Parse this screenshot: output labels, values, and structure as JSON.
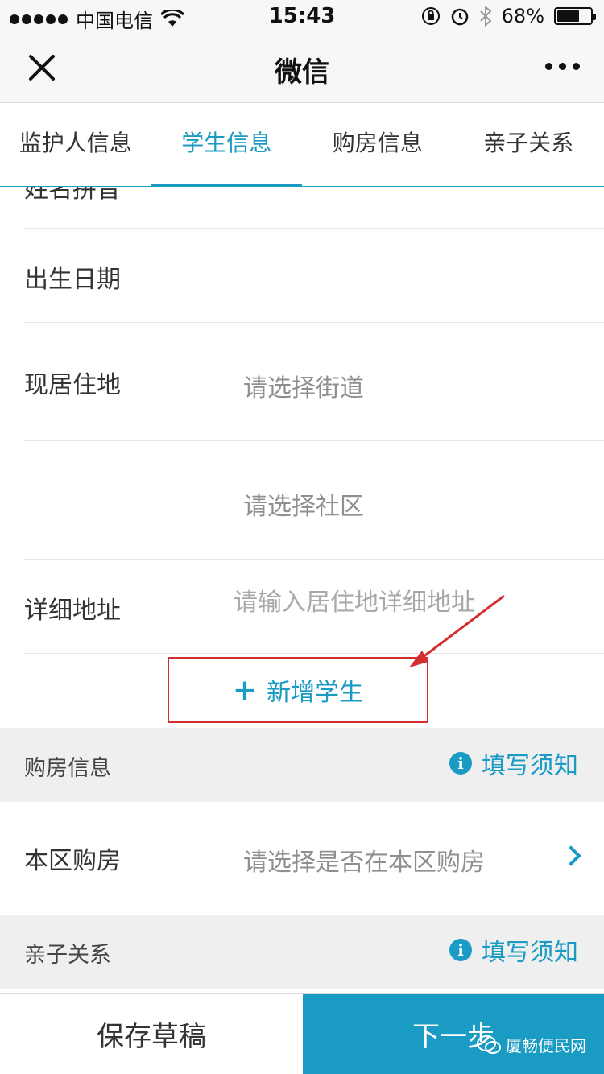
{
  "status": {
    "carrier": "中国电信",
    "time": "15:43",
    "battery_text": "68%",
    "battery_level": 0.68
  },
  "nav": {
    "title": "微信"
  },
  "tabs": [
    {
      "label": "监护人信息"
    },
    {
      "label": "学生信息"
    },
    {
      "label": "购房信息"
    },
    {
      "label": "亲子关系"
    }
  ],
  "form": {
    "cutoff_label": "姓名拼音",
    "birth_label": "出生日期",
    "residence_label": "现居住地",
    "street_placeholder": "请选择街道",
    "community_placeholder": "请选择社区",
    "address_label": "详细地址",
    "address_placeholder": "请输入居住地详细地址"
  },
  "add_student": {
    "label": "新增学生"
  },
  "housing": {
    "title": "购房信息",
    "notice": "填写须知",
    "row_label": "本区购房",
    "row_placeholder": "请选择是否在本区购房"
  },
  "parent_child": {
    "title": "亲子关系",
    "notice": "填写须知"
  },
  "bottom": {
    "draft": "保存草稿",
    "next": "下一步"
  },
  "watermark": {
    "text": "厦畅便民网"
  },
  "colors": {
    "accent": "#1a9bc4",
    "annotation": "#d32f2f"
  }
}
